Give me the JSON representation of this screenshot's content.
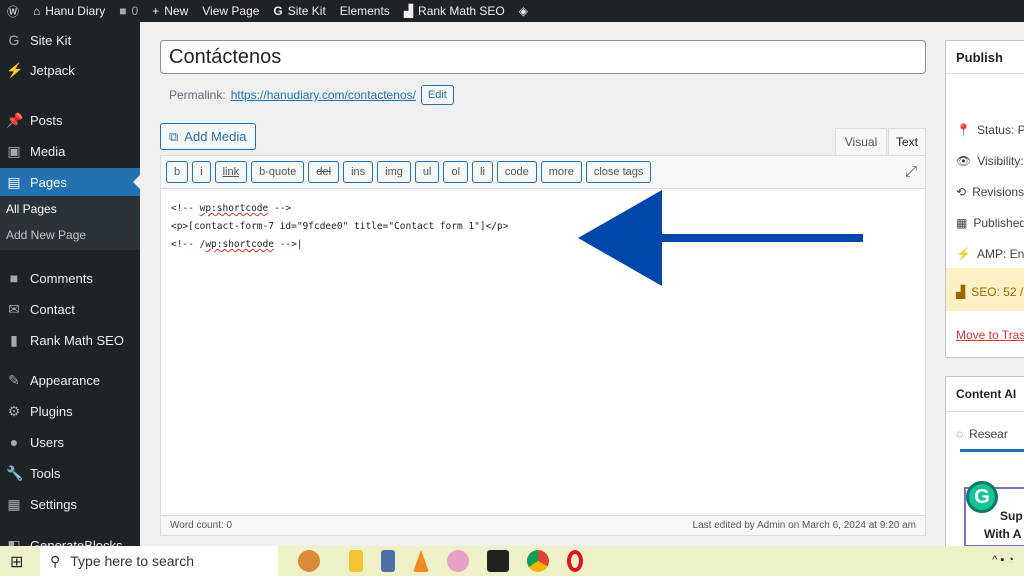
{
  "adminbar": {
    "site": "Hanu Diary",
    "comments": "0",
    "new": "New",
    "view": "View Page",
    "sitekit": "Site Kit",
    "elements": "Elements",
    "rankmath": "Rank Math SEO"
  },
  "sidebar": {
    "items": [
      {
        "label": "Site Kit",
        "icon": "G"
      },
      {
        "label": "Jetpack",
        "icon": "⚡"
      },
      {
        "label": "Posts",
        "icon": "📌"
      },
      {
        "label": "Media",
        "icon": "▣"
      },
      {
        "label": "Pages",
        "icon": "▤"
      },
      {
        "label": "Comments",
        "icon": "■"
      },
      {
        "label": "Contact",
        "icon": "✉"
      },
      {
        "label": "Rank Math SEO",
        "icon": "▮"
      },
      {
        "label": "Appearance",
        "icon": "✎"
      },
      {
        "label": "Plugins",
        "icon": "⚙"
      },
      {
        "label": "Users",
        "icon": "●"
      },
      {
        "label": "Tools",
        "icon": "🔧"
      },
      {
        "label": "Settings",
        "icon": "▦"
      },
      {
        "label": "GenerateBlocks",
        "icon": "◧"
      }
    ],
    "sub": [
      "All Pages",
      "Add New Page"
    ]
  },
  "editor": {
    "title": "Contáctenos",
    "permalink_label": "Permalink:",
    "permalink": "https://hanudiary.com/contactenos/",
    "edit": "Edit",
    "add_media": "Add Media",
    "tab_visual": "Visual",
    "tab_text": "Text",
    "quicktags": [
      "b",
      "i",
      "link",
      "b-quote",
      "del",
      "ins",
      "img",
      "ul",
      "ol",
      "li",
      "code",
      "more",
      "close tags"
    ],
    "lines": [
      "<!-- ",
      "wp:shortcode",
      " -->",
      "<p>[contact-form-7 id=\"9fcdee0\" title=\"Contact form 1\"]</p>",
      "<!-- /",
      "wp:shortcode",
      " -->"
    ],
    "word_count": "Word count: 0",
    "last_edited": "Last edited by Admin on March 6, 2024 at 9:20 am"
  },
  "arrow_color": "#0047ab",
  "publish": {
    "title": "Publish",
    "rows": [
      "Status: P",
      "Visibility:",
      "Revisions",
      "Published",
      "AMP: Ena"
    ],
    "seo": "SEO: 52 /",
    "trash": "Move to Tras"
  },
  "content_ai": {
    "title": "Content AI",
    "tab": "Resear",
    "promo": [
      "Sup",
      "With A"
    ]
  },
  "taskbar": {
    "search": "Type here to search"
  }
}
